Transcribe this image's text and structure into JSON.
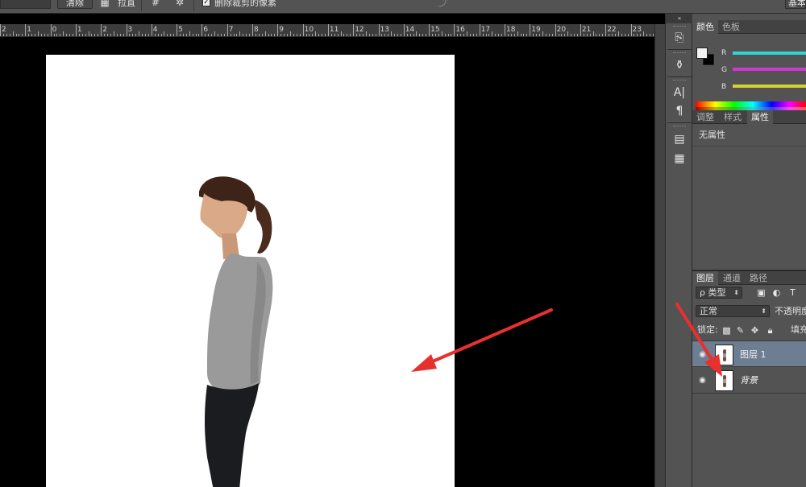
{
  "options_bar": {
    "clear_button": "清除",
    "straighten_label": "拉直",
    "delete_cropped_checked": true,
    "delete_cropped_label": "删除裁剪的像素",
    "workspace_button": "基本功能"
  },
  "ruler": {
    "labels": [
      "2",
      "1",
      "0",
      "1",
      "2",
      "3",
      "4",
      "5",
      "6",
      "7",
      "8",
      "9",
      "10",
      "11",
      "12",
      "13",
      "14",
      "15",
      "16",
      "17",
      "18",
      "19",
      "20",
      "21",
      "22",
      "23"
    ]
  },
  "color_panel": {
    "tabs": [
      "颜色",
      "色板"
    ],
    "active_tab": 0,
    "foreground_color": "#f2f2f2",
    "background_color": "#000000",
    "channels": [
      {
        "label": "R",
        "color": "#36d3d3"
      },
      {
        "label": "G",
        "color": "#d336d3"
      },
      {
        "label": "B",
        "color": "#d3d336"
      }
    ]
  },
  "properties_panel": {
    "tabs": [
      "调整",
      "样式",
      "属性"
    ],
    "active_tab": 2,
    "content": "无属性"
  },
  "layers_panel": {
    "tabs": [
      "图层",
      "通道",
      "路径"
    ],
    "active_tab": 0,
    "filter_kind": "ρ 类型",
    "blend_mode": "正常",
    "opacity_label": "不透明度:",
    "lock_label": "锁定:",
    "fill_label": "填充",
    "layers": [
      {
        "name": "图层 1",
        "selected": true,
        "italic": false
      },
      {
        "name": "背景",
        "selected": false,
        "italic": true
      }
    ]
  },
  "annotations": {
    "arrow_color": "#e8302e"
  }
}
